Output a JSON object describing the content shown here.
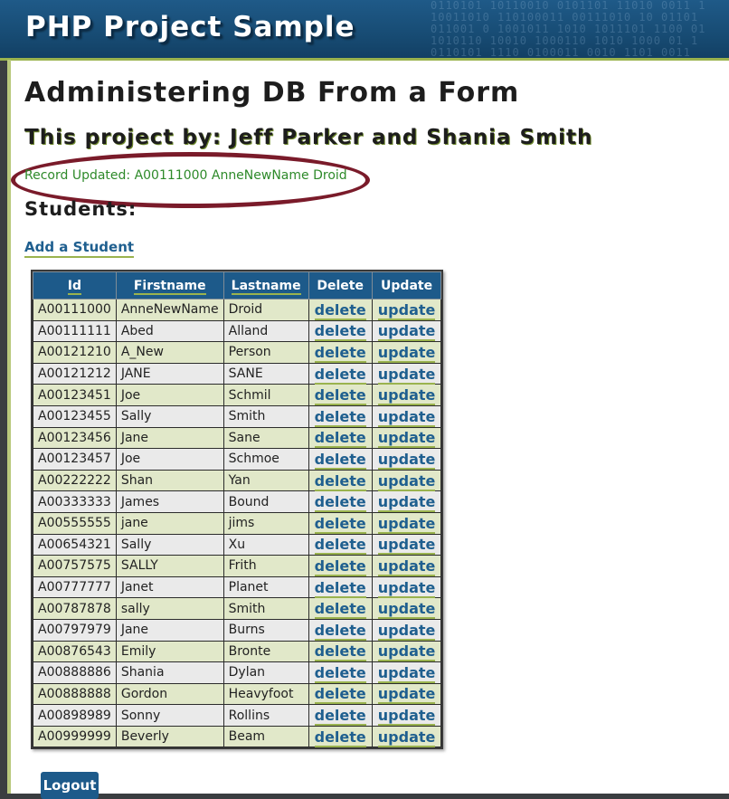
{
  "site": {
    "title": "PHP Project Sample",
    "binary_pattern": "0110101 10110010 0101101 11010 0011 1\n10011010 110100011 00111010 10 01101\n011001 0 1001011 1010 1011101 1100 01\n1010110 10010 1000110 1010 1000 01 1\n0110101 1110 0100011 0010 1101 0011"
  },
  "page": {
    "heading": "Administering DB From a Form",
    "subheading": "This project by: Jeff Parker and Shania Smith",
    "status_message": "Record Updated: A00111000 AnneNewName Droid",
    "students_heading": "Students:",
    "add_student_label": "Add a Student",
    "logout_label": "Logout"
  },
  "table": {
    "headers": {
      "id": "Id",
      "firstname": "Firstname",
      "lastname": "Lastname",
      "delete": "Delete",
      "update": "Update"
    },
    "delete_label": "delete",
    "update_label": "update",
    "rows": [
      {
        "id": "A00111000",
        "first": "AnneNewName",
        "last": "Droid"
      },
      {
        "id": "A00111111",
        "first": "Abed",
        "last": "Alland"
      },
      {
        "id": "A00121210",
        "first": "A_New",
        "last": "Person"
      },
      {
        "id": "A00121212",
        "first": "JANE",
        "last": "SANE"
      },
      {
        "id": "A00123451",
        "first": "Joe",
        "last": "Schmil"
      },
      {
        "id": "A00123455",
        "first": "Sally",
        "last": "Smith"
      },
      {
        "id": "A00123456",
        "first": "Jane",
        "last": "Sane"
      },
      {
        "id": "A00123457",
        "first": "Joe",
        "last": "Schmoe"
      },
      {
        "id": "A00222222",
        "first": "Shan",
        "last": "Yan"
      },
      {
        "id": "A00333333",
        "first": "James",
        "last": "Bound"
      },
      {
        "id": "A00555555",
        "first": "jane",
        "last": "jims"
      },
      {
        "id": "A00654321",
        "first": "Sally",
        "last": "Xu"
      },
      {
        "id": "A00757575",
        "first": "SALLY",
        "last": "Frith"
      },
      {
        "id": "A00777777",
        "first": "Janet",
        "last": "Planet"
      },
      {
        "id": "A00787878",
        "first": "sally",
        "last": "Smith"
      },
      {
        "id": "A00797979",
        "first": "Jane",
        "last": "Burns"
      },
      {
        "id": "A00876543",
        "first": "Emily",
        "last": "Bronte"
      },
      {
        "id": "A00888886",
        "first": "Shania",
        "last": "Dylan"
      },
      {
        "id": "A00888888",
        "first": "Gordon",
        "last": "Heavyfoot"
      },
      {
        "id": "A00898989",
        "first": "Sonny",
        "last": "Rollins"
      },
      {
        "id": "A00999999",
        "first": "Beverly",
        "last": "Beam"
      }
    ]
  },
  "colors": {
    "banner": "#1d5a8a",
    "accent_underline": "#9ab34e",
    "status_text": "#2e8a2a",
    "highlight_oval": "#7a1b2a",
    "row_odd": "#e1e8c9",
    "row_even": "#eaeaea"
  }
}
